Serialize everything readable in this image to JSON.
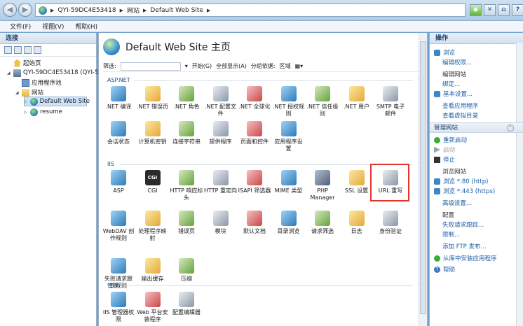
{
  "address": {
    "segments": [
      "QYI-59DC4E53418",
      "网站",
      "Default Web Site"
    ]
  },
  "menu": [
    "文件(F)",
    "视图(V)",
    "帮助(H)"
  ],
  "connections": {
    "header": "连接",
    "tree": [
      {
        "label": "起始页",
        "icon": "home-icon"
      },
      {
        "label": "QYI-59DC4E53418 (QYI-59",
        "icon": "server-icon"
      },
      {
        "label": "应用程序池",
        "icon": "app-pool-icon"
      },
      {
        "label": "网站",
        "icon": "folder-icon"
      },
      {
        "label": "Default Web Site",
        "icon": "globe-icon"
      },
      {
        "label": "resume",
        "icon": "globe-icon"
      }
    ]
  },
  "center": {
    "title": "Default Web Site 主页",
    "filter_label": "筛选:",
    "start_label": "开始(G)",
    "show_all_label": "全部显示(A)",
    "group_label": "分组依据:",
    "group_value": "区域",
    "sections": {
      "aspnet": "ASP.NET",
      "iis": "IIS",
      "management": "管理"
    },
    "aspnet_features": [
      [
        ".NET 编译",
        ""
      ],
      [
        ".NET 错误页",
        ""
      ],
      [
        ".NET 角色",
        ""
      ],
      [
        ".NET 配置文",
        "件"
      ],
      [
        ".NET 全球化",
        ""
      ],
      [
        ".NET 授权规",
        "则"
      ],
      [
        ".NET 信任级",
        "别"
      ],
      [
        ".NET 用户",
        ""
      ],
      [
        "SMTP 电子",
        "邮件"
      ],
      [
        "会话状态",
        ""
      ],
      [
        "计算机密钥",
        ""
      ],
      [
        "连接字符串",
        ""
      ],
      [
        "提供程序",
        ""
      ],
      [
        "页面和控件",
        ""
      ],
      [
        "应用程序设",
        "置"
      ]
    ],
    "iis_features": [
      [
        "ASP",
        ""
      ],
      [
        "CGI",
        ""
      ],
      [
        "HTTP 响应标",
        "头"
      ],
      [
        "HTTP 重定向",
        ""
      ],
      [
        "ISAPI 筛选器",
        ""
      ],
      [
        "MIME 类型",
        ""
      ],
      [
        "PHP",
        "Manager"
      ],
      [
        "SSL 设置",
        ""
      ],
      [
        "URL 重写",
        ""
      ],
      [
        "WebDAV 创",
        "作规则"
      ],
      [
        "处理程序映",
        "射"
      ],
      [
        "错误页",
        ""
      ],
      [
        "模块",
        ""
      ],
      [
        "默认文档",
        ""
      ],
      [
        "目录浏览",
        ""
      ],
      [
        "请求筛选",
        ""
      ],
      [
        "日志",
        ""
      ],
      [
        "身份验证",
        ""
      ],
      [
        "失败请求跟",
        "踪规则"
      ],
      [
        "输出缓存",
        ""
      ],
      [
        "压缩",
        ""
      ]
    ],
    "management_features": [
      [
        "IIS 管理器权",
        "限"
      ],
      [
        "Web 平台安",
        "装程序"
      ],
      [
        "配置编辑器",
        ""
      ]
    ]
  },
  "actions": {
    "header": "操作",
    "explore": "浏览",
    "edit_permissions": "编辑权限...",
    "edit_site_head": "编辑网站",
    "bindings": "绑定...",
    "basic_settings": "基本设置...",
    "view_apps": "查看应用程序",
    "view_vdirs": "查看虚拟目录",
    "manage_site": "管理网站",
    "restart": "重新启动",
    "start": "启动",
    "stop": "停止",
    "browse_site_head": "浏览网站",
    "browse_80": "浏览 *:80 (http)",
    "browse_443": "浏览 *:443 (https)",
    "advanced": "高级设置...",
    "config_head": "配置",
    "failed_req": "失败请求跟踪...",
    "limits": "限制...",
    "add_ftp": "添加 FTP 发布...",
    "install_gallery": "从库中安装应用程序",
    "help": "帮助"
  }
}
